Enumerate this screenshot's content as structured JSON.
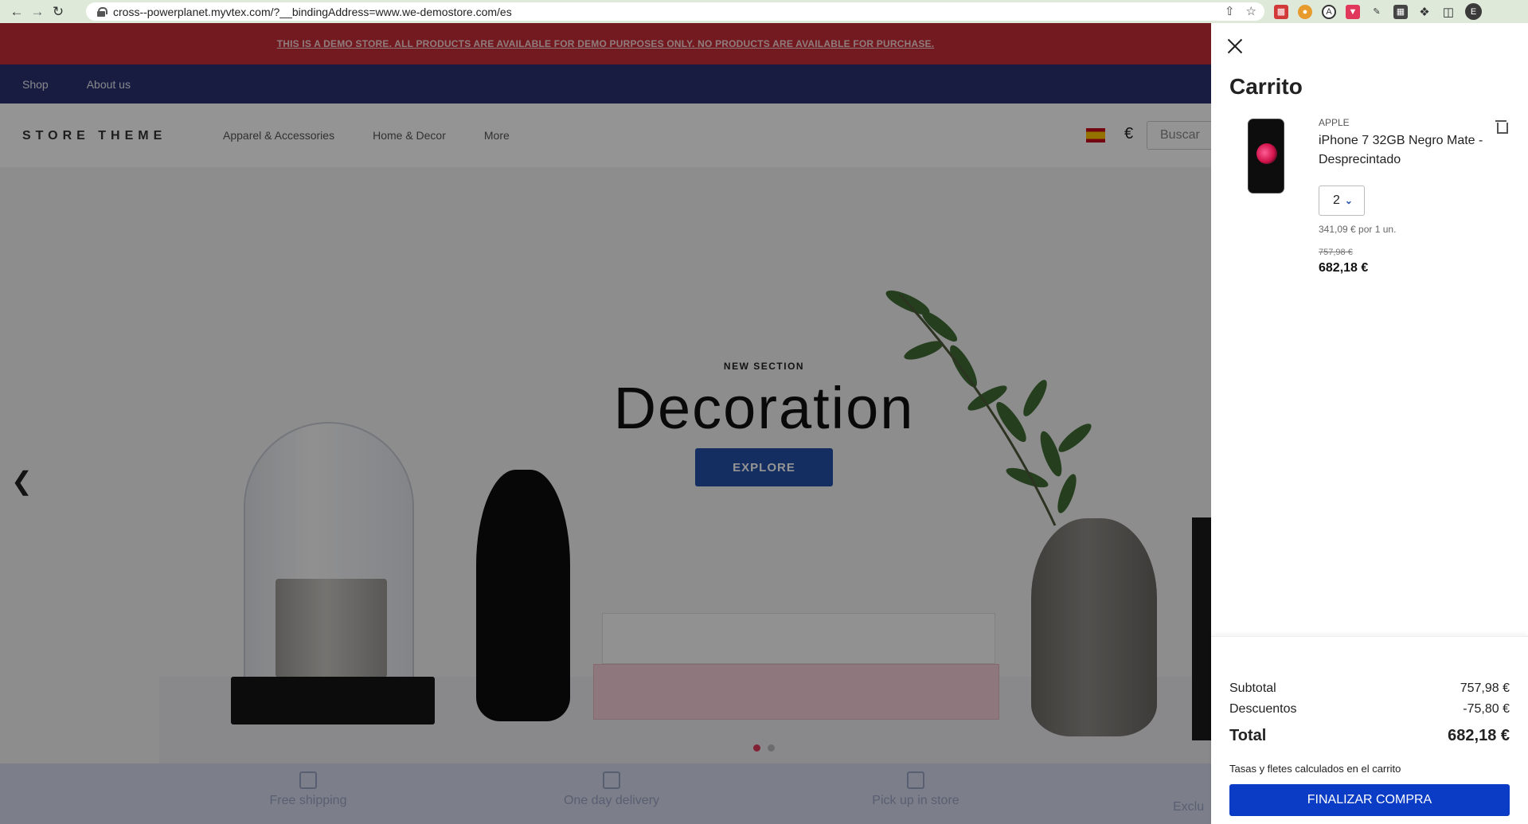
{
  "browser": {
    "url": "cross--powerplanet.myvtex.com/?__bindingAddress=www.we-demostore.com/es",
    "profile_initial": "E"
  },
  "store": {
    "demo_banner": "THIS IS A DEMO STORE. ALL PRODUCTS ARE AVAILABLE FOR DEMO PURPOSES ONLY. NO PRODUCTS ARE AVAILABLE FOR PURCHASE.",
    "topnav": [
      "Shop",
      "About us"
    ],
    "logo": "STORE THEME",
    "menu": [
      "Apparel & Accessories",
      "Home & Decor",
      "More"
    ],
    "currency_symbol": "€",
    "search_placeholder": "Buscar",
    "hero": {
      "kicker": "NEW SECTION",
      "title": "Decoration",
      "button": "EXPLORE",
      "active_slide": 1,
      "slide_count": 2
    },
    "features": [
      "Free shipping",
      "One day delivery",
      "Pick up in store",
      "Exclu"
    ]
  },
  "cart": {
    "title": "Carrito",
    "item": {
      "brand": "APPLE",
      "name": "iPhone 7 32GB Negro Mate - Desprecintado",
      "quantity": "2",
      "unit_price": "341,09 € por 1 un.",
      "list_price": "757,98 €",
      "price": "682,18 €"
    },
    "summary": {
      "subtotal_label": "Subtotal",
      "subtotal_value": "757,98 €",
      "discount_label": "Descuentos",
      "discount_value": "-75,80 €",
      "total_label": "Total",
      "total_value": "682,18 €",
      "tax_note": "Tasas y fletes calculados en el carrito",
      "checkout_button": "FINALIZAR COMPRA"
    }
  },
  "colors": {
    "banner": "#c62e37",
    "topnav": "#2a3170",
    "explore": "#2450a7",
    "checkout": "#0a3cc6"
  }
}
